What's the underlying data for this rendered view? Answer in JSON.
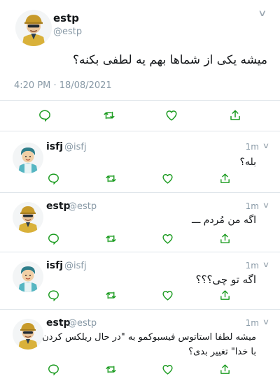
{
  "main_tweet": {
    "author_name": "estp",
    "author_handle": "@estp",
    "text": "میشه یکی از شماها بهم یه لطفی بکنه؟",
    "timestamp": "4:20 PM · 18/08/2021",
    "action_icons": [
      "reply-icon",
      "retweet-icon",
      "like-icon",
      "share-icon"
    ]
  },
  "replies": [
    {
      "author_name": "isfj",
      "author_handle": "@isfj",
      "time_ago": "1m",
      "text": "بله؟"
    },
    {
      "author_name": "estp",
      "author_handle": "@estp",
      "time_ago": "1m",
      "text": "اگه من مُردم ـــ"
    },
    {
      "author_name": "isfj",
      "author_handle": "@isfj",
      "time_ago": "1m",
      "text": "اگه تو چی؟؟؟"
    },
    {
      "author_name": "estp",
      "author_handle": "@estp",
      "time_ago": "1m",
      "text": "میشه لطفا استاتوس فیسبوکمو به \"در حال ریلکس کردن با خدا\" تغییر بدی؟"
    }
  ],
  "colors": {
    "icon_green": "#1a9b1f",
    "secondary_text": "#8899a6",
    "divider": "#dfe5ea"
  }
}
